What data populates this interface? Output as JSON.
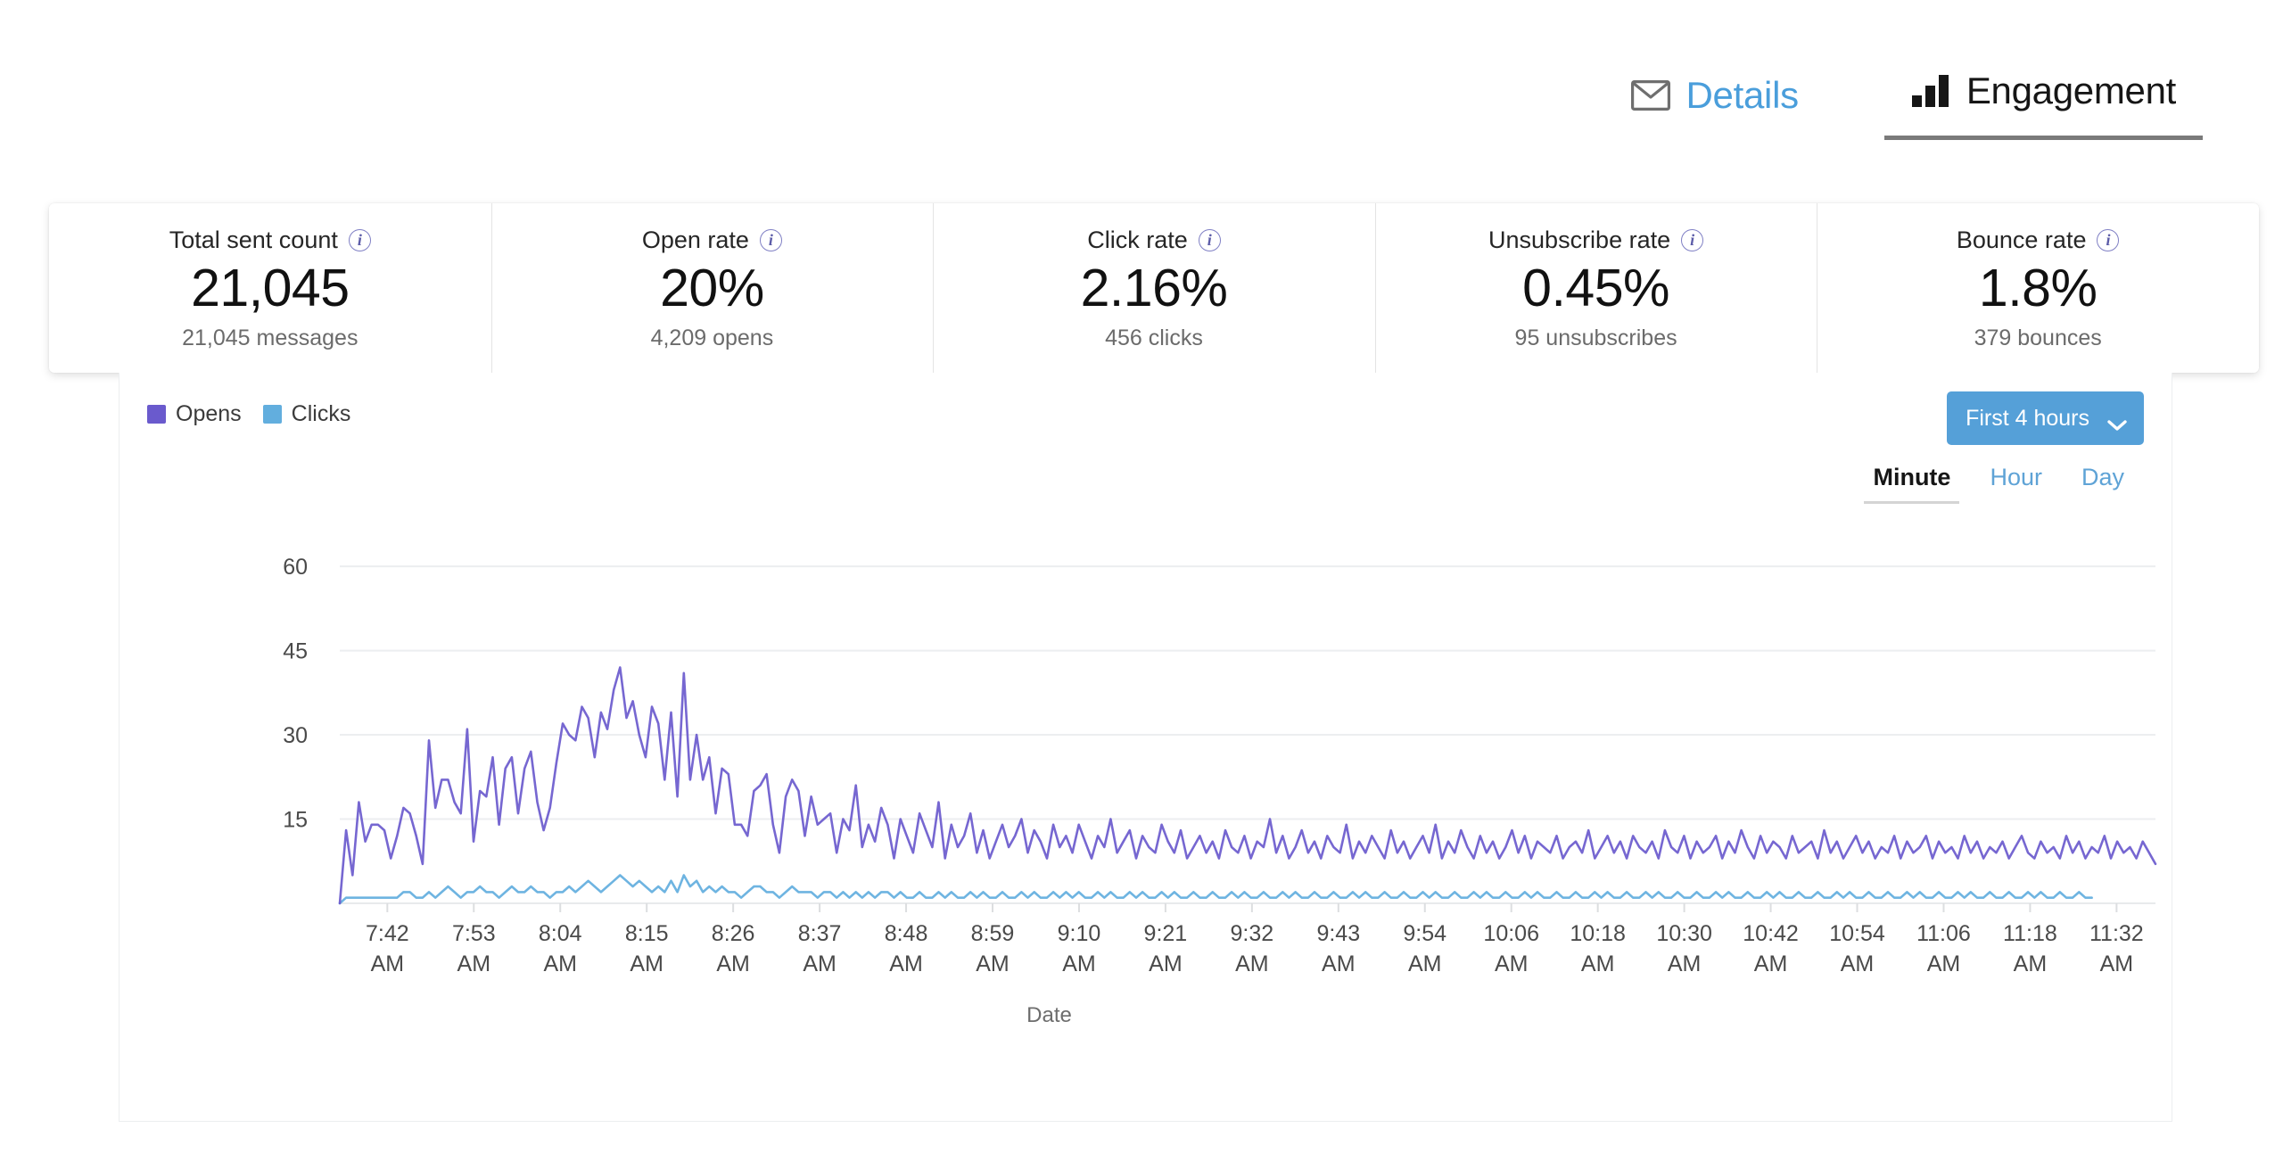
{
  "tabs": [
    {
      "id": "details",
      "label": "Details",
      "icon": "mail-icon",
      "active": false,
      "color": "#4a9edb"
    },
    {
      "id": "engagement",
      "label": "Engagement",
      "icon": "bar-chart-icon",
      "active": true,
      "color": "#161616"
    }
  ],
  "metrics": [
    {
      "label": "Total sent count",
      "value": "21,045",
      "sub": "21,045 messages",
      "info": "i"
    },
    {
      "label": "Open rate",
      "value": "20%",
      "sub": "4,209 opens",
      "info": "i"
    },
    {
      "label": "Click rate",
      "value": "2.16%",
      "sub": "456 clicks",
      "info": "i"
    },
    {
      "label": "Unsubscribe rate",
      "value": "0.45%",
      "sub": "95 unsubscribes",
      "info": "i"
    },
    {
      "label": "Bounce rate",
      "value": "1.8%",
      "sub": "379 bounces",
      "info": "i"
    }
  ],
  "chart_panel": {
    "legend": [
      {
        "label": "Opens",
        "color": "#6a5acd"
      },
      {
        "label": "Clicks",
        "color": "#62aede"
      }
    ],
    "range_select": {
      "value": "First 4 hours",
      "icon": "chevron-down-icon",
      "bg": "#55a0d8"
    },
    "granularity": [
      {
        "label": "Minute",
        "active": true
      },
      {
        "label": "Hour",
        "active": false
      },
      {
        "label": "Day",
        "active": false
      }
    ]
  },
  "chart_data": {
    "type": "line",
    "title": "",
    "xlabel": "Date",
    "ylabel": "",
    "ylim": [
      0,
      67
    ],
    "yticks": [
      15,
      30,
      45,
      60
    ],
    "grid": true,
    "legend_position": "top-left",
    "xtick_labels": [
      "7:42 AM",
      "7:53 AM",
      "8:04 AM",
      "8:15 AM",
      "8:26 AM",
      "8:37 AM",
      "8:48 AM",
      "8:59 AM",
      "9:10 AM",
      "9:21 AM",
      "9:32 AM",
      "9:43 AM",
      "9:54 AM",
      "10:06 AM",
      "10:18 AM",
      "10:30 AM",
      "10:42 AM",
      "10:54 AM",
      "11:06 AM",
      "11:18 AM",
      "11:32 AM"
    ],
    "series": [
      {
        "name": "Opens",
        "color": "#6a5acd",
        "values": [
          0,
          13,
          5,
          18,
          11,
          14,
          14,
          13,
          8,
          12,
          17,
          16,
          12,
          7,
          29,
          17,
          22,
          22,
          18,
          16,
          31,
          11,
          20,
          19,
          26,
          14,
          24,
          26,
          16,
          24,
          27,
          18,
          13,
          17,
          25,
          32,
          30,
          29,
          35,
          33,
          26,
          34,
          31,
          38,
          42,
          33,
          36,
          30,
          26,
          35,
          32,
          22,
          34,
          19,
          41,
          22,
          30,
          22,
          26,
          16,
          24,
          23,
          14,
          14,
          12,
          20,
          21,
          23,
          14,
          9,
          19,
          22,
          20,
          12,
          19,
          14,
          15,
          16,
          9,
          15,
          13,
          21,
          10,
          14,
          11,
          17,
          14,
          8,
          15,
          12,
          9,
          16,
          13,
          10,
          18,
          8,
          14,
          10,
          12,
          16,
          9,
          13,
          8,
          11,
          14,
          10,
          12,
          15,
          9,
          13,
          11,
          8,
          14,
          10,
          12,
          9,
          14,
          11,
          8,
          12,
          10,
          15,
          9,
          11,
          13,
          8,
          12,
          10,
          9,
          14,
          11,
          9,
          13,
          8,
          10,
          12,
          9,
          11,
          8,
          13,
          10,
          9,
          12,
          8,
          11,
          10,
          15,
          9,
          12,
          8,
          10,
          13,
          9,
          11,
          8,
          12,
          10,
          9,
          14,
          8,
          11,
          9,
          12,
          10,
          8,
          13,
          9,
          11,
          8,
          10,
          12,
          9,
          14,
          8,
          11,
          9,
          13,
          10,
          8,
          12,
          9,
          11,
          8,
          10,
          13,
          9,
          12,
          8,
          11,
          10,
          9,
          12,
          8,
          10,
          11,
          9,
          13,
          8,
          10,
          12,
          9,
          11,
          8,
          12,
          10,
          9,
          11,
          8,
          13,
          10,
          9,
          12,
          8,
          11,
          9,
          10,
          12,
          8,
          11,
          9,
          13,
          10,
          8,
          12,
          9,
          11,
          10,
          8,
          12,
          9,
          10,
          11,
          8,
          13,
          9,
          11,
          8,
          10,
          12,
          9,
          11,
          8,
          10,
          9,
          12,
          8,
          11,
          9,
          10,
          12,
          8,
          11,
          9,
          10,
          8,
          12,
          9,
          11,
          8,
          10,
          9,
          11,
          8,
          10,
          12,
          9,
          8,
          11,
          9,
          10,
          8,
          12,
          9,
          11,
          8,
          10,
          9,
          12,
          8,
          11,
          9,
          10,
          8,
          11,
          9,
          7
        ]
      },
      {
        "name": "Clicks",
        "color": "#62aede",
        "values": [
          0,
          1,
          1,
          1,
          1,
          1,
          1,
          1,
          1,
          1,
          2,
          2,
          1,
          1,
          2,
          1,
          2,
          3,
          2,
          1,
          2,
          2,
          3,
          2,
          2,
          1,
          2,
          3,
          2,
          2,
          3,
          2,
          2,
          1,
          2,
          2,
          3,
          2,
          3,
          4,
          3,
          2,
          3,
          4,
          5,
          4,
          3,
          4,
          3,
          2,
          3,
          2,
          4,
          2,
          5,
          3,
          4,
          2,
          3,
          2,
          3,
          2,
          2,
          1,
          2,
          3,
          3,
          2,
          2,
          1,
          2,
          3,
          2,
          2,
          2,
          1,
          2,
          2,
          1,
          2,
          1,
          2,
          1,
          2,
          1,
          2,
          2,
          1,
          2,
          1,
          1,
          2,
          1,
          1,
          2,
          1,
          2,
          1,
          1,
          2,
          1,
          2,
          1,
          1,
          2,
          1,
          1,
          2,
          1,
          2,
          1,
          1,
          2,
          1,
          2,
          1,
          2,
          1,
          1,
          2,
          1,
          2,
          1,
          1,
          2,
          1,
          2,
          1,
          1,
          2,
          1,
          2,
          1,
          1,
          2,
          1,
          1,
          2,
          1,
          1,
          2,
          1,
          2,
          1,
          1,
          2,
          1,
          1,
          2,
          1,
          2,
          1,
          1,
          2,
          1,
          1,
          2,
          1,
          1,
          2,
          1,
          2,
          1,
          1,
          2,
          1,
          1,
          2,
          1,
          1,
          2,
          1,
          2,
          1,
          1,
          2,
          1,
          1,
          2,
          1,
          2,
          1,
          1,
          2,
          1,
          1,
          2,
          1,
          2,
          1,
          1,
          2,
          1,
          1,
          2,
          1,
          1,
          2,
          1,
          2,
          1,
          1,
          2,
          1,
          1,
          2,
          1,
          2,
          1,
          1,
          2,
          1,
          1,
          2,
          1,
          1,
          2,
          1,
          2,
          1,
          1,
          2,
          1,
          1,
          2,
          1,
          2,
          1,
          1,
          2,
          1,
          1,
          2,
          1,
          1,
          2,
          1,
          2,
          1,
          1,
          2,
          1,
          1,
          2,
          1,
          1,
          2,
          1,
          2,
          1,
          1,
          2,
          1,
          1,
          2,
          1,
          2,
          1,
          1,
          2,
          1,
          1,
          2,
          1,
          1,
          2,
          1,
          2,
          1,
          1,
          2,
          1,
          1,
          2,
          1,
          1
        ]
      }
    ]
  }
}
